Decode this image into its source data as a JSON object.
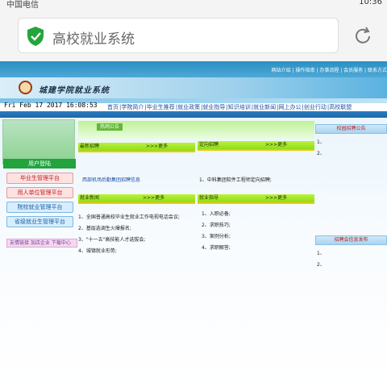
{
  "status": {
    "carrier": "中国电信",
    "time": "10:36"
  },
  "browser": {
    "url_text": "高校就业系统",
    "reload_icon": "reload-icon",
    "secure_icon": "shield-check-icon"
  },
  "header": {
    "top_links": "网站介绍 | 操作指南 | 办事流程 | 会员服务 | 联系方式",
    "site_title": "城建学院就业系统",
    "date": "Fri Feb 17 2017 16:08:53",
    "nav": [
      "首页",
      "学院简介",
      "毕业生推荐",
      "就业政策",
      "就业指导",
      "知识培训",
      "就业新闻",
      "网上办公",
      "创业行动",
      "高校联盟"
    ]
  },
  "left": {
    "login_label": "用户登陆",
    "platforms": [
      "毕业生管理平台",
      "用人单位管理平台",
      "院校就业管理平台",
      "省级就业生管理平台"
    ],
    "friend_link": "友情链接 加店企业 下载中心"
  },
  "center": {
    "hot_tab": "热网公告",
    "latest_jobs": {
      "title": "最新招聘",
      "more": ">>>更多",
      "items": [
        "西部机场后勤集团招聘信息"
      ]
    },
    "targeted_jobs": {
      "title": "定向招聘",
      "more": ">>>更多",
      "items": [
        "1、中科集团软件工程师定向招聘;"
      ]
    },
    "job_news": {
      "title": "就业新闻",
      "more": ">>>更多",
      "items": [
        "1、全国普通高校毕业生就业工作电视电话会议;",
        "2、基层选调生火爆报名;",
        "3、\"十一五\"高技能人才选拔会;",
        "4、城镇就业形势;"
      ]
    },
    "job_guide": {
      "title": "就业指导",
      "more": ">>>更多",
      "items": [
        "1、入职必备;",
        "2、求职技巧;",
        "3、案例分析;",
        "4、求职解答;"
      ]
    }
  },
  "right": {
    "notice_title": "校园招聘公告",
    "notice_items": [
      "1、",
      "2、"
    ],
    "release_title": "招聘会信息发布",
    "release_items": [
      "1、",
      "2、"
    ]
  },
  "colors": {
    "accent_blue": "#2a7cc0",
    "green_bar": "#8fdc1a",
    "yellow_line": "#f3c70d"
  }
}
